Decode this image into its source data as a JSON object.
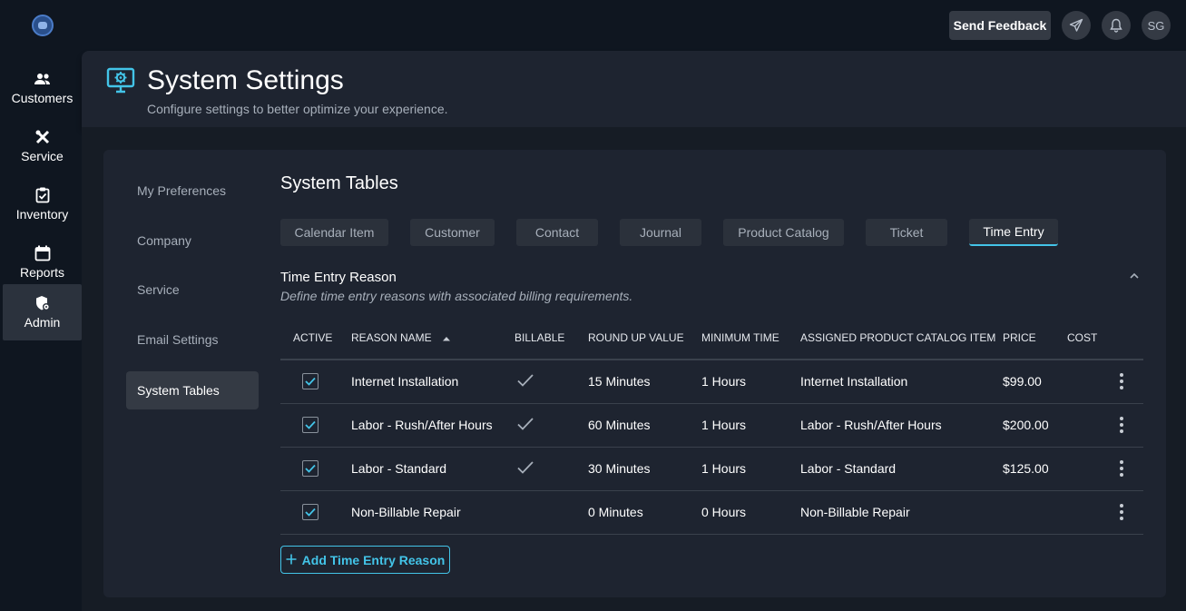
{
  "app": {
    "user_initials": "SG",
    "feedback_label": "Send Feedback"
  },
  "nav": {
    "items": [
      {
        "label": "Customers",
        "icon": "people-icon"
      },
      {
        "label": "Service",
        "icon": "tools-icon"
      },
      {
        "label": "Inventory",
        "icon": "clipboard-check-icon"
      },
      {
        "label": "Reports",
        "icon": "calendar-icon"
      },
      {
        "label": "Admin",
        "icon": "shield-gear-icon"
      }
    ],
    "active": "Admin"
  },
  "header": {
    "title": "System Settings",
    "subtitle": "Configure settings to better optimize your experience."
  },
  "settings_menu": {
    "items": [
      "My Preferences",
      "Company",
      "Service",
      "Email Settings",
      "System Tables"
    ],
    "active": "System Tables"
  },
  "system_tables": {
    "title": "System Tables",
    "tabs": [
      "Calendar Item",
      "Customer",
      "Contact",
      "Journal",
      "Product Catalog",
      "Ticket",
      "Time Entry"
    ],
    "active_tab": "Time Entry"
  },
  "time_entry_reason": {
    "title": "Time Entry Reason",
    "description": "Define time entry reasons with associated billing requirements.",
    "columns": [
      "ACTIVE",
      "REASON NAME",
      "BILLABLE",
      "ROUND UP VALUE",
      "MINIMUM TIME",
      "ASSIGNED PRODUCT CATALOG ITEM",
      "PRICE",
      "COST"
    ],
    "sort_column": "REASON NAME",
    "rows": [
      {
        "active": true,
        "name": "Internet Installation",
        "billable": true,
        "round_up": "15 Minutes",
        "minimum": "1 Hours",
        "product": "Internet Installation",
        "price": "$99.00",
        "cost": ""
      },
      {
        "active": true,
        "name": "Labor - Rush/After Hours",
        "billable": true,
        "round_up": "60 Minutes",
        "minimum": "1 Hours",
        "product": "Labor - Rush/After Hours",
        "price": "$200.00",
        "cost": ""
      },
      {
        "active": true,
        "name": "Labor - Standard",
        "billable": true,
        "round_up": "30 Minutes",
        "minimum": "1 Hours",
        "product": "Labor - Standard",
        "price": "$125.00",
        "cost": ""
      },
      {
        "active": true,
        "name": "Non-Billable Repair",
        "billable": false,
        "round_up": "0 Minutes",
        "minimum": "0 Hours",
        "product": "Non-Billable Repair",
        "price": "",
        "cost": ""
      }
    ],
    "add_label": "Add Time Entry Reason"
  },
  "colors": {
    "accent": "#43c4e8",
    "background": "#0f1620",
    "panel": "#1e2430"
  }
}
